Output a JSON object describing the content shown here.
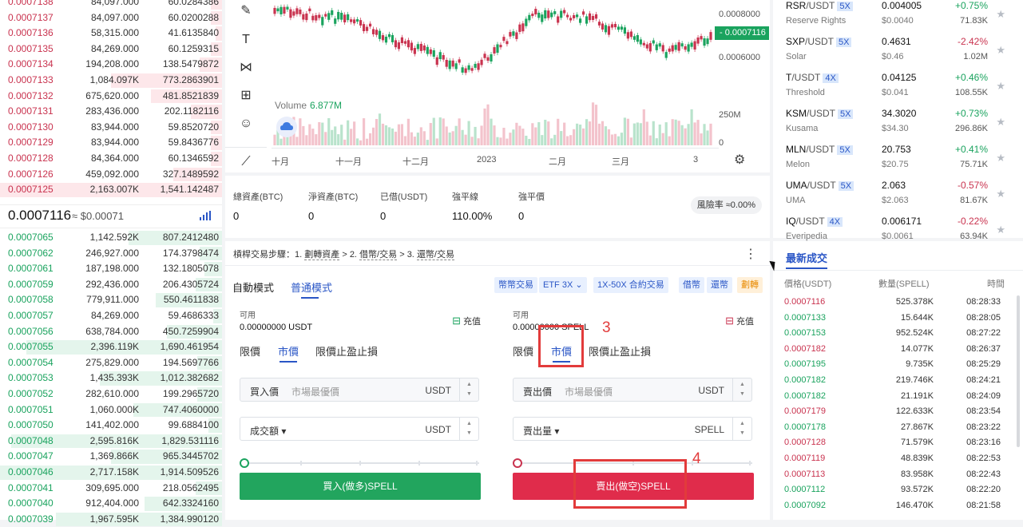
{
  "orderbook": {
    "asks": [
      {
        "p": "0.0007138",
        "a": "84,097.000",
        "t": "60.0284386",
        "d": 0.05
      },
      {
        "p": "0.0007137",
        "a": "84,097.000",
        "t": "60.0200288",
        "d": 0.05
      },
      {
        "p": "0.0007136",
        "a": "58,315.000",
        "t": "41.6135840",
        "d": 0.03
      },
      {
        "p": "0.0007135",
        "a": "84,269.000",
        "t": "60.1259315",
        "d": 0.05
      },
      {
        "p": "0.0007134",
        "a": "194,208.000",
        "t": "138.5479872",
        "d": 0.1
      },
      {
        "p": "0.0007133",
        "a": "1,084.097K",
        "t": "773.2863901",
        "d": 0.5
      },
      {
        "p": "0.0007132",
        "a": "675,620.000",
        "t": "481.8521839",
        "d": 0.32
      },
      {
        "p": "0.0007131",
        "a": "283,436.000",
        "t": "202.1182116",
        "d": 0.14
      },
      {
        "p": "0.0007130",
        "a": "83,944.000",
        "t": "59.8520720",
        "d": 0.05
      },
      {
        "p": "0.0007129",
        "a": "83,944.000",
        "t": "59.8436776",
        "d": 0.05
      },
      {
        "p": "0.0007128",
        "a": "84,364.000",
        "t": "60.1346592",
        "d": 0.05
      },
      {
        "p": "0.0007126",
        "a": "459,092.000",
        "t": "327.1489592",
        "d": 0.22
      },
      {
        "p": "0.0007125",
        "a": "2,163.007K",
        "t": "1,541.142487",
        "d": 1.0
      }
    ],
    "last_price": "0.0007116",
    "last_fiat": "≈ $0.00071",
    "bids": [
      {
        "p": "0.0007065",
        "a": "1,142.592K",
        "t": "807.2412480",
        "d": 0.42
      },
      {
        "p": "0.0007062",
        "a": "246,927.000",
        "t": "174.3798474",
        "d": 0.1
      },
      {
        "p": "0.0007061",
        "a": "187,198.000",
        "t": "132.1805078",
        "d": 0.08
      },
      {
        "p": "0.0007059",
        "a": "292,436.000",
        "t": "206.4305724",
        "d": 0.12
      },
      {
        "p": "0.0007058",
        "a": "779,911.000",
        "t": "550.4611838",
        "d": 0.3
      },
      {
        "p": "0.0007057",
        "a": "84,269.000",
        "t": "59.4686333",
        "d": 0.04
      },
      {
        "p": "0.0007056",
        "a": "638,784.000",
        "t": "450.7259904",
        "d": 0.25
      },
      {
        "p": "0.0007055",
        "a": "2,396.119K",
        "t": "1,690.461954",
        "d": 0.88
      },
      {
        "p": "0.0007054",
        "a": "275,829.000",
        "t": "194.5697766",
        "d": 0.11
      },
      {
        "p": "0.0007053",
        "a": "1,435.393K",
        "t": "1,012.382682",
        "d": 0.55
      },
      {
        "p": "0.0007052",
        "a": "282,610.000",
        "t": "199.2965720",
        "d": 0.11
      },
      {
        "p": "0.0007051",
        "a": "1,060.000K",
        "t": "747.4060000",
        "d": 0.4
      },
      {
        "p": "0.0007050",
        "a": "141,402.000",
        "t": "99.6884100",
        "d": 0.06
      },
      {
        "p": "0.0007048",
        "a": "2,595.816K",
        "t": "1,829.531116",
        "d": 0.95
      },
      {
        "p": "0.0007047",
        "a": "1,369.866K",
        "t": "965.3445702",
        "d": 0.5
      },
      {
        "p": "0.0007046",
        "a": "2,717.158K",
        "t": "1,914.509526",
        "d": 1.0
      },
      {
        "p": "0.0007041",
        "a": "309,695.000",
        "t": "218.0562495",
        "d": 0.12
      },
      {
        "p": "0.0007040",
        "a": "912,404.000",
        "t": "642.3324160",
        "d": 0.35
      },
      {
        "p": "0.0007039",
        "a": "1,967.595K",
        "t": "1,384.990120",
        "d": 0.75
      }
    ]
  },
  "chart": {
    "price_labels": [
      "0.0008000",
      "0.0006000"
    ],
    "current_price": "0.0007116",
    "volume_label": "Volume",
    "volume_value": "6.877M",
    "volume_axis": [
      "250M",
      "0"
    ],
    "months": [
      "十月",
      "十一月",
      "十二月",
      "2023",
      "二月",
      "三月",
      "3"
    ],
    "tool_icons": [
      "pen-icon",
      "text-icon",
      "pattern-icon",
      "measure-icon",
      "emoji-icon",
      "ruler-icon"
    ]
  },
  "account": {
    "cols": [
      {
        "label": "總資產(BTC)",
        "value": "0"
      },
      {
        "label": "淨資產(BTC)",
        "value": "0"
      },
      {
        "label": "已借(USDT)",
        "value": "0"
      },
      {
        "label": "強平線",
        "value": "110.00%"
      },
      {
        "label": "強平價",
        "value": "0"
      }
    ],
    "risk": "風險率 ≈0.00%"
  },
  "trade": {
    "steps": [
      "槓桿交易步驟：1.",
      "劃轉資產",
      ">",
      "2.",
      "借幣/交易",
      ">",
      "3.",
      "還幣/交易"
    ],
    "modes": [
      "自動模式",
      "普通模式"
    ],
    "chips": [
      "幣幣交易",
      "ETF 3X",
      "1X-50X 合約交易",
      "借幣",
      "還幣",
      "劃轉"
    ],
    "buy": {
      "avail_label": "可用",
      "avail_value": "0.00000000 USDT",
      "deposit": "充值",
      "tabs": [
        "限價",
        "市價",
        "限價止盈止損"
      ],
      "price_label": "買入價",
      "price_ph": "市場最優價",
      "price_unit": "USDT",
      "amount_label": "成交額",
      "amount_unit": "USDT",
      "button": "買入(做多)SPELL"
    },
    "sell": {
      "avail_label": "可用",
      "avail_value": "0.00000000 SPELL",
      "deposit": "充值",
      "tabs": [
        "限價",
        "市價",
        "限價止盈止損"
      ],
      "price_label": "賣出價",
      "price_ph": "市場最優價",
      "price_unit": "USDT",
      "amount_label": "賣出量",
      "amount_unit": "SPELL",
      "button": "賣出(做空)SPELL"
    },
    "annotations": [
      "3",
      "4"
    ]
  },
  "markets": [
    {
      "base": "RSR",
      "quote": "/USDT",
      "lev": "5X",
      "name": "Reserve Rights",
      "price": "0.004005",
      "fiat": "$0.0040",
      "chg": "+0.75%",
      "vol": "71.83K",
      "dir": "up"
    },
    {
      "base": "SXP",
      "quote": "/USDT",
      "lev": "5X",
      "name": "Solar",
      "price": "0.4631",
      "fiat": "$0.46",
      "chg": "-2.42%",
      "vol": "1.02M",
      "dir": "down"
    },
    {
      "base": "T",
      "quote": "/USDT",
      "lev": "4X",
      "name": "Threshold",
      "price": "0.04125",
      "fiat": "$0.041",
      "chg": "+0.46%",
      "vol": "108.55K",
      "dir": "up"
    },
    {
      "base": "KSM",
      "quote": "/USDT",
      "lev": "5X",
      "name": "Kusama",
      "price": "34.3020",
      "fiat": "$34.30",
      "chg": "+0.73%",
      "vol": "296.86K",
      "dir": "up"
    },
    {
      "base": "MLN",
      "quote": "/USDT",
      "lev": "5X",
      "name": "Melon",
      "price": "20.753",
      "fiat": "$20.75",
      "chg": "+0.41%",
      "vol": "75.71K",
      "dir": "up"
    },
    {
      "base": "UMA",
      "quote": "/USDT",
      "lev": "5X",
      "name": "UMA",
      "price": "2.063",
      "fiat": "$2.063",
      "chg": "-0.57%",
      "vol": "81.67K",
      "dir": "down"
    },
    {
      "base": "IQ",
      "quote": "/USDT",
      "lev": "4X",
      "name": "Everipedia",
      "price": "0.006171",
      "fiat": "$0.0061",
      "chg": "-0.22%",
      "vol": "63.94K",
      "dir": "down"
    }
  ],
  "trades": {
    "title": "最新成交",
    "headers": [
      "價格(USDT)",
      "數量(SPELL)",
      "時間"
    ],
    "rows": [
      {
        "p": "0.0007116",
        "a": "525.378K",
        "t": "08:28:33",
        "dir": "down"
      },
      {
        "p": "0.0007133",
        "a": "15.644K",
        "t": "08:28:05",
        "dir": "up"
      },
      {
        "p": "0.0007153",
        "a": "952.524K",
        "t": "08:27:22",
        "dir": "up"
      },
      {
        "p": "0.0007182",
        "a": "14.077K",
        "t": "08:26:37",
        "dir": "down"
      },
      {
        "p": "0.0007195",
        "a": "9.735K",
        "t": "08:25:29",
        "dir": "up"
      },
      {
        "p": "0.0007182",
        "a": "219.746K",
        "t": "08:24:21",
        "dir": "up"
      },
      {
        "p": "0.0007182",
        "a": "21.191K",
        "t": "08:24:09",
        "dir": "up"
      },
      {
        "p": "0.0007179",
        "a": "122.633K",
        "t": "08:23:54",
        "dir": "down"
      },
      {
        "p": "0.0007178",
        "a": "27.867K",
        "t": "08:23:22",
        "dir": "up"
      },
      {
        "p": "0.0007128",
        "a": "71.579K",
        "t": "08:23:16",
        "dir": "down"
      },
      {
        "p": "0.0007119",
        "a": "48.839K",
        "t": "08:22:53",
        "dir": "down"
      },
      {
        "p": "0.0007113",
        "a": "83.958K",
        "t": "08:22:43",
        "dir": "down"
      },
      {
        "p": "0.0007112",
        "a": "93.572K",
        "t": "08:22:20",
        "dir": "up"
      },
      {
        "p": "0.0007092",
        "a": "146.470K",
        "t": "08:21:58",
        "dir": "up"
      }
    ]
  },
  "colors": {
    "up": "#1aa35e",
    "down": "#c9334f",
    "accent": "#2a56c6",
    "annotation": "#e23b3b"
  }
}
